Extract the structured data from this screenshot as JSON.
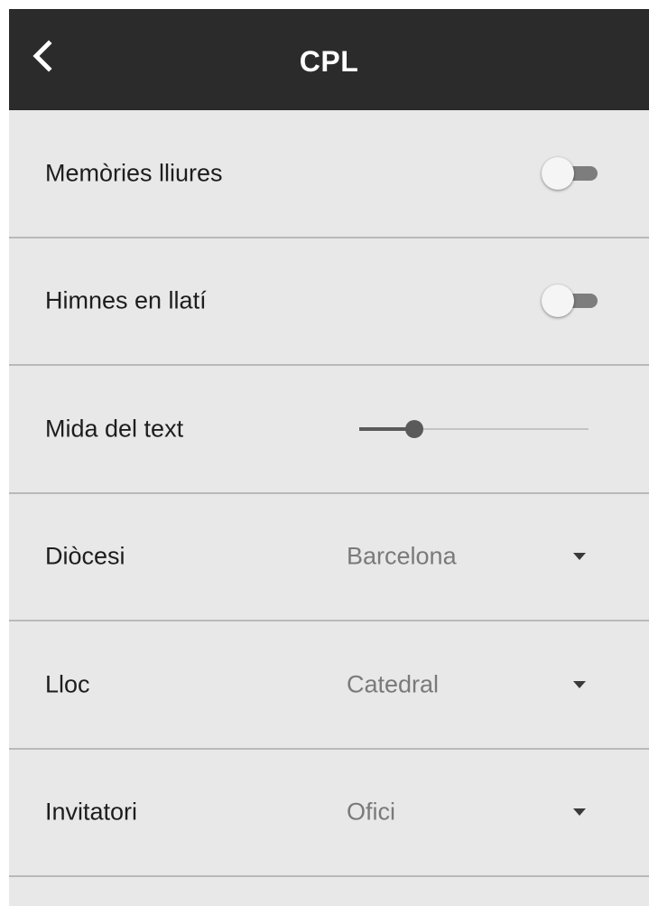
{
  "app_bar": {
    "title": "CPL",
    "back_icon": "chevron-left-icon"
  },
  "settings": {
    "free_memories": {
      "label": "Memòries lliures",
      "enabled": false
    },
    "latin_hymns": {
      "label": "Himnes en llatí",
      "enabled": false
    },
    "text_size": {
      "label": "Mida del text",
      "level_fraction": 0.24
    },
    "diocese": {
      "label": "Diòcesi",
      "value": "Barcelona"
    },
    "place": {
      "label": "Lloc",
      "value": "Catedral"
    },
    "invitatory": {
      "label": "Invitatori",
      "value": "Ofici"
    }
  },
  "colors": {
    "app_bar_background": "#2b2b2b",
    "page_background": "#e8e8e8",
    "divider": "#b9b9b9",
    "switch_track_off": "#7d7d7d",
    "slider_active": "#5a5a5a"
  }
}
